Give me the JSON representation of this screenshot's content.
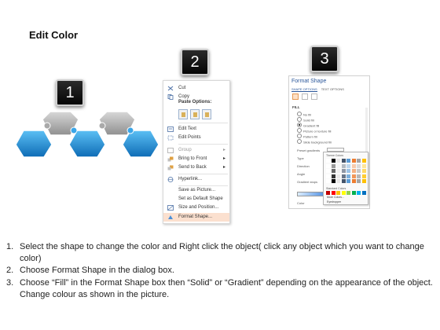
{
  "title": "Edit Color",
  "badges": [
    "1",
    "2",
    "3"
  ],
  "context_menu": {
    "items": [
      {
        "label": "Cut",
        "icon": "scissors-icon"
      },
      {
        "label": "Copy",
        "icon": "copy-icon"
      },
      {
        "label": "Edit Text",
        "icon": "edit-text-icon"
      },
      {
        "label": "Edit Points",
        "icon": "edit-points-icon"
      },
      {
        "label": "Group",
        "icon": "group-icon",
        "disabled": true
      },
      {
        "label": "Bring to Front",
        "icon": "bring-front-icon",
        "submenu": true
      },
      {
        "label": "Send to Back",
        "icon": "send-back-icon",
        "submenu": true
      },
      {
        "label": "Hyperlink...",
        "icon": "hyperlink-icon"
      },
      {
        "label": "Save as Picture..."
      },
      {
        "label": "Set as Default Shape"
      },
      {
        "label": "Size and Position...",
        "icon": "size-position-icon"
      },
      {
        "label": "Format Shape...",
        "icon": "format-shape-icon",
        "highlight": true
      }
    ],
    "paste_header": "Paste Options:"
  },
  "format_pane": {
    "title": "Format Shape",
    "tabs": [
      "SHAPE OPTIONS",
      "TEXT OPTIONS"
    ],
    "section": "FILL",
    "fill_options": [
      "No fill",
      "Solid fill",
      "Gradient fill",
      "Picture or texture fill",
      "Pattern fill",
      "Slide background fill"
    ],
    "checked_option": "Gradient fill",
    "fields": [
      "Preset gradients",
      "Type",
      "Direction",
      "Angle",
      "Gradient stops",
      "Color"
    ],
    "palette": {
      "label": "Theme Colors",
      "standard_label": "Standard Colors",
      "more_colors": "More Colors...",
      "eyedropper": "Eyedropper"
    }
  },
  "instructions": [
    {
      "num": "1.",
      "text": "Select the shape to change the color and Right click the object( click any object which you want to change color)"
    },
    {
      "num": "2.",
      "text": "Choose Format Shape in the dialog box."
    },
    {
      "num": "3.",
      "text": "Choose “Fill” in the Format Shape box then “Solid” or “Gradient” depending on the appearance of the object. Change colour as shown in the picture."
    }
  ],
  "colors": {
    "accent_blue": "#1e8bd6",
    "gray_piece": "#a6a6a6",
    "menu_highlight": "#fbe0cf",
    "pane_title": "#2b579a"
  }
}
